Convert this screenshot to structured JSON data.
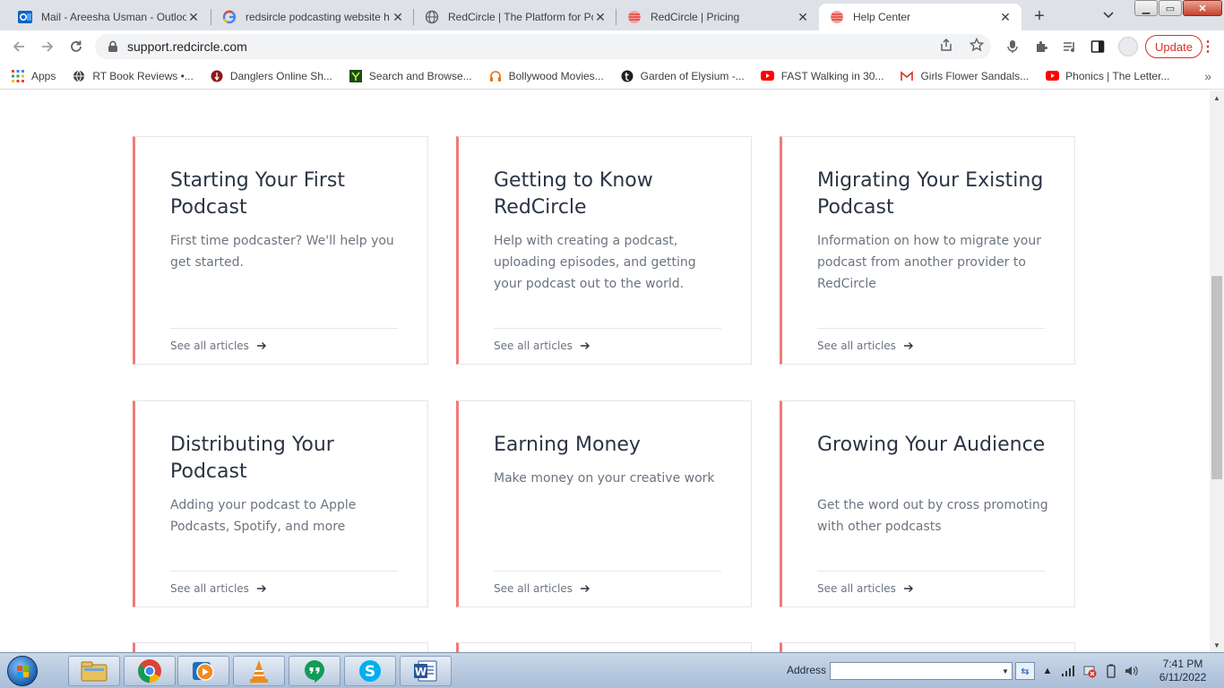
{
  "browser": {
    "tabs": [
      {
        "title": "Mail - Areesha Usman - Outlook",
        "icon": "outlook-icon"
      },
      {
        "title": "redsircle podcasting website h",
        "icon": "google-icon"
      },
      {
        "title": "RedCircle | The Platform for Po",
        "icon": "globe-icon"
      },
      {
        "title": "RedCircle | Pricing",
        "icon": "redcircle-icon"
      },
      {
        "title": "Help Center",
        "icon": "redcircle-icon"
      }
    ],
    "address": "support.redcircle.com",
    "update_label": "Update",
    "bookmarks": [
      {
        "label": "Apps",
        "icon": "apps-grid-icon"
      },
      {
        "label": "RT Book Reviews •...",
        "icon": "globe-icon"
      },
      {
        "label": "Danglers Online Sh...",
        "icon": "danglers-icon"
      },
      {
        "label": "Search and Browse...",
        "icon": "y-icon"
      },
      {
        "label": "Bollywood Movies...",
        "icon": "headphones-icon"
      },
      {
        "label": "Garden of Elysium -...",
        "icon": "tumblr-icon"
      },
      {
        "label": "FAST Walking in 30...",
        "icon": "youtube-icon"
      },
      {
        "label": "Girls Flower Sandals...",
        "icon": "gmail-icon"
      },
      {
        "label": "Phonics | The Letter...",
        "icon": "youtube-icon"
      }
    ]
  },
  "help_center": {
    "link_label": "See all articles",
    "cards": [
      {
        "title": "Starting Your First Podcast",
        "description": "First time podcaster? We'll help you get started."
      },
      {
        "title": "Getting to Know RedCircle",
        "description": "Help with creating a podcast, uploading episodes, and getting your podcast out to the world."
      },
      {
        "title": "Migrating Your Existing Podcast",
        "description": "Information on how to migrate your podcast from another provider to RedCircle"
      },
      {
        "title": "Distributing Your Podcast",
        "description": "Adding your podcast to Apple Podcasts, Spotify, and more"
      },
      {
        "title": "Earning Money",
        "description": "Make money on your creative work"
      },
      {
        "title": "Growing Your Audience",
        "description": "Get the word out by cross promoting with other podcasts"
      }
    ]
  },
  "taskbar": {
    "address_label": "Address",
    "address_value": "",
    "time": "7:41 PM",
    "date": "6/11/2022",
    "apps": [
      "file-explorer-icon",
      "chrome-icon",
      "media-player-icon",
      "vlc-icon",
      "hangouts-icon",
      "skype-icon",
      "word-icon"
    ]
  },
  "colors": {
    "card_accent": "#ef7b78",
    "title_text": "#2b3443",
    "body_text": "#6b7480",
    "update_red": "#d93025"
  }
}
